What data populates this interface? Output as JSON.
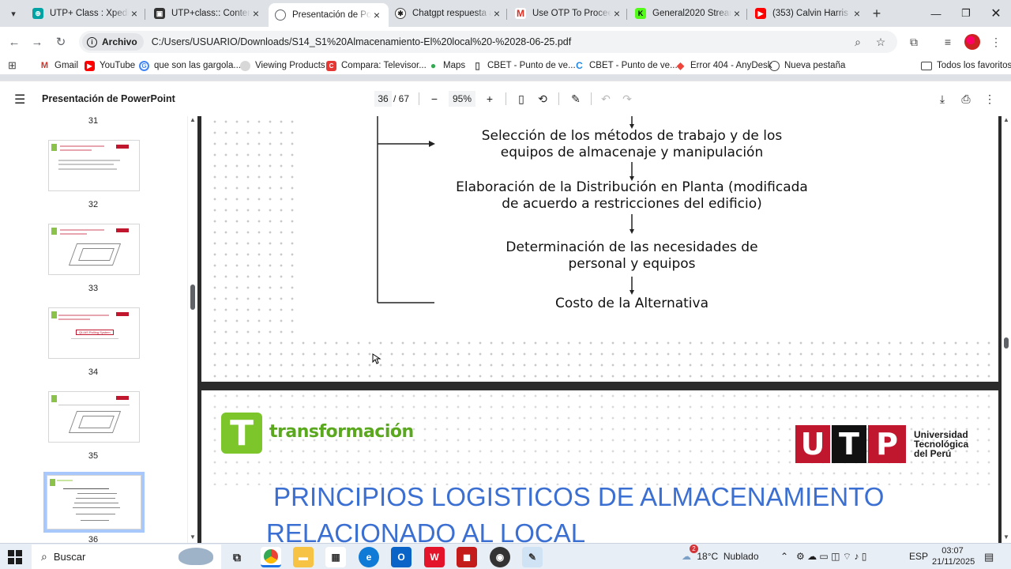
{
  "tabs": [
    {
      "title": "UTP+ Class : Xpedition"
    },
    {
      "title": "UTP+class:: Contenido"
    },
    {
      "title": "Presentación de PowerPoint",
      "active": true
    },
    {
      "title": "Chatgpt respuesta al"
    },
    {
      "title": "Use OTP To Proceed"
    },
    {
      "title": "General2020 Stream"
    },
    {
      "title": "(353) Calvin Harris - "
    }
  ],
  "address": {
    "chip_label": "Archivo",
    "url": "C:/Users/USUARIO/Downloads/S14_S1%20Almacenamiento-El%20local%20-%2028-06-25.pdf"
  },
  "bookmarks": [
    {
      "label": "Gmail"
    },
    {
      "label": "YouTube"
    },
    {
      "label": "que son las gargola..."
    },
    {
      "label": "Viewing Products"
    },
    {
      "label": "Compara: Televisor..."
    },
    {
      "label": "Maps"
    },
    {
      "label": "CBET - Punto de ve..."
    },
    {
      "label": "CBET - Punto de ve..."
    },
    {
      "label": "Error 404 - AnyDesk"
    },
    {
      "label": "Nueva pestaña"
    },
    {
      "label": "Todos los favoritos"
    }
  ],
  "pdf": {
    "title": "Presentación de PowerPoint",
    "current_page": "36",
    "total_pages": "/ 67",
    "zoom": "95%"
  },
  "thumbnails": {
    "top_number": "31",
    "numbers": [
      "32",
      "33",
      "34",
      "35",
      "36"
    ],
    "thumb34_highlight": "QLIAS Rolling System"
  },
  "slide1": {
    "steps": [
      "Selección de los métodos de trabajo y de los\nequipos de almacenaje y manipulación",
      "Elaboración de la Distribución en Planta (modificada\nde acuerdo a restricciones del edificio)",
      "Determinación de las necesidades de\npersonal y equipos",
      "Costo de la Alternativa"
    ]
  },
  "slide2": {
    "brand_letter": "T",
    "brand_word": "transformación",
    "utp_letters": [
      "U",
      "T",
      "P"
    ],
    "utp_text": [
      "Universidad",
      "Tecnológica",
      "del Perú"
    ],
    "title_line1": " PRINCIPIOS LOGISTICOS DE ALMACENAMIENTO",
    "title_line2": "RELACIONADO AL LOCAL"
  },
  "taskbar": {
    "search_placeholder": "Buscar",
    "weather": "18°C  Nublado",
    "notification_count": "2",
    "language": "ESP",
    "time": "03:07",
    "date": "21/11/2025"
  },
  "colors": {
    "utp_red": "#c0172f",
    "brand_green": "#7cc62b",
    "title_blue": "#3b6fd1",
    "selection_blue": "#a8c7fa"
  }
}
